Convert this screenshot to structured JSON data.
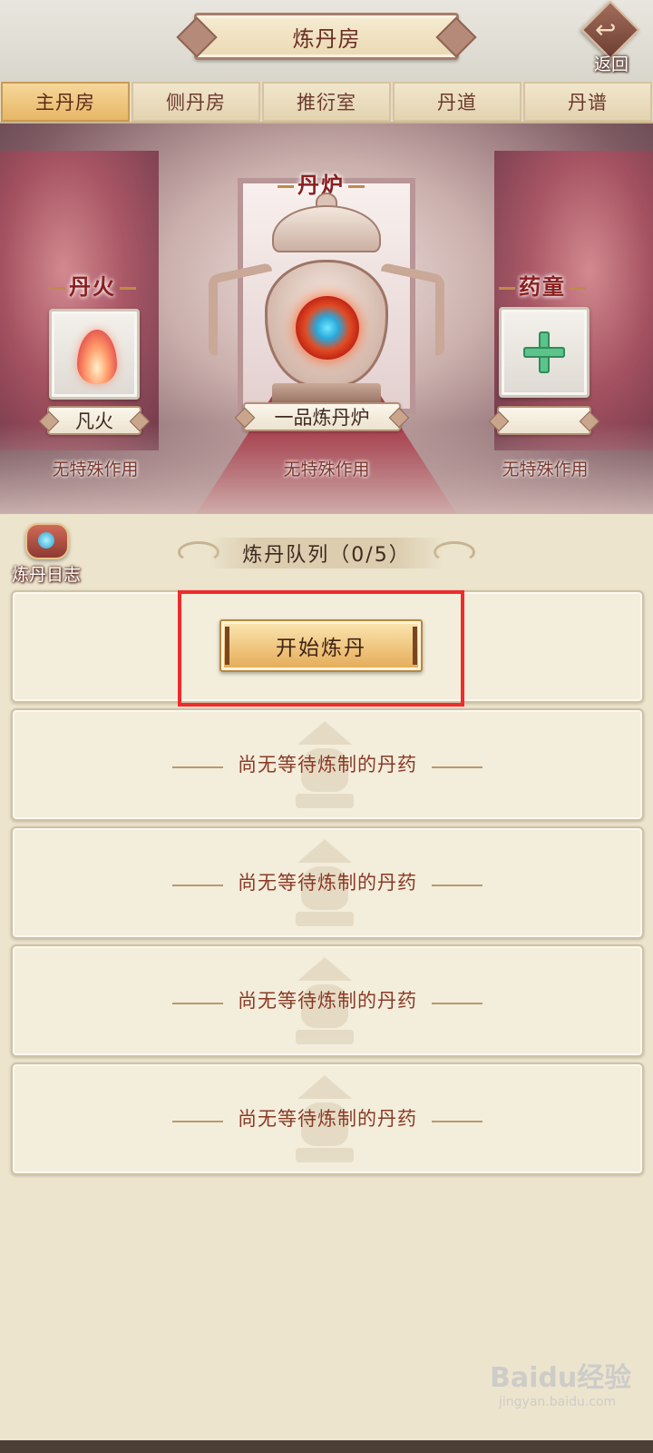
{
  "header": {
    "title": "炼丹房",
    "back_label": "返回"
  },
  "tabs": [
    {
      "label": "主丹房",
      "active": true
    },
    {
      "label": "侧丹房",
      "active": false
    },
    {
      "label": "推衍室",
      "active": false
    },
    {
      "label": "丹道",
      "active": false
    },
    {
      "label": "丹谱",
      "active": false
    }
  ],
  "scene": {
    "fire": {
      "title": "丹火",
      "name": "凡火",
      "effect": "无特殊作用"
    },
    "furnace": {
      "title": "丹炉",
      "name": "一品炼丹炉",
      "effect": "无特殊作用"
    },
    "attendant": {
      "title": "药童",
      "name": "",
      "effect": "无特殊作用"
    }
  },
  "journal": {
    "label": "炼丹日志"
  },
  "queue": {
    "title": "炼丹队列（0/5）",
    "start_button": "开始炼丹",
    "empty_slots": [
      "尚无等待炼制的丹药",
      "尚无等待炼制的丹药",
      "尚无等待炼制的丹药",
      "尚无等待炼制的丹药"
    ]
  },
  "watermark": {
    "brand": "Baidu经验",
    "sub": "jingyan.baidu.com"
  },
  "colors": {
    "accent_red": "#ee2c2c",
    "tab_active": "#e7b767",
    "title_text": "#6a2e22"
  }
}
